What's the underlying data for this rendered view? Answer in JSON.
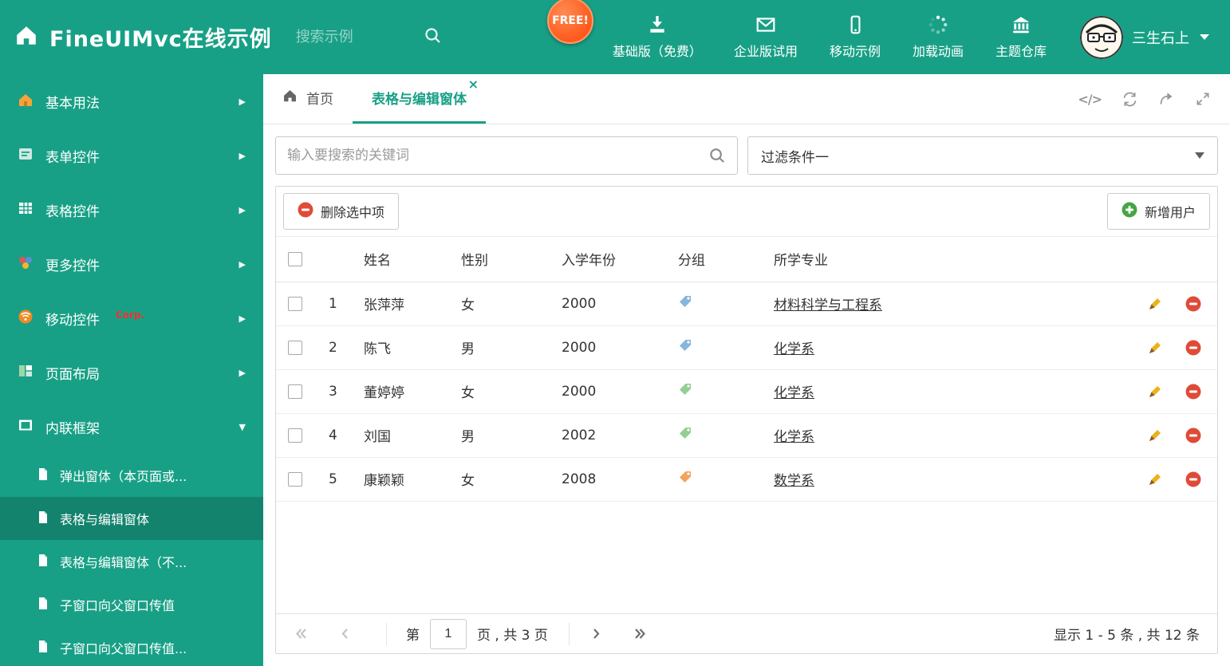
{
  "colors": {
    "accent": "#18a086",
    "free_badge": "#ff5a1e",
    "danger": "#df4b38",
    "success": "#46a546",
    "pencil": "#eab31c",
    "tag_blue": "#85b7dd",
    "tag_green": "#93cf93",
    "tag_orange": "#f2a45f"
  },
  "icons": {
    "close": "×",
    "code": "</>",
    "chevron_right": "▶",
    "chevron_down": "▼"
  },
  "header": {
    "title": "FineUIMvc在线示例",
    "search_placeholder": "搜索示例",
    "free_badge": "FREE!",
    "nav": [
      {
        "label": "基础版（免费）",
        "icon": "download-icon"
      },
      {
        "label": "企业版试用",
        "icon": "envelope-icon"
      },
      {
        "label": "移动示例",
        "icon": "mobile-icon"
      },
      {
        "label": "加载动画",
        "icon": "spinner-icon"
      },
      {
        "label": "主题仓库",
        "icon": "bank-icon"
      }
    ],
    "user_name": "三生石上"
  },
  "sidebar": {
    "items": [
      {
        "label": "基本用法"
      },
      {
        "label": "表单控件"
      },
      {
        "label": "表格控件"
      },
      {
        "label": "更多控件"
      },
      {
        "label": "移动控件",
        "badge": "Corp."
      },
      {
        "label": "页面布局"
      },
      {
        "label": "内联框架"
      }
    ],
    "subitems": [
      {
        "label": "弹出窗体（本页面或..."
      },
      {
        "label": "表格与编辑窗体"
      },
      {
        "label": "表格与编辑窗体（不..."
      },
      {
        "label": "子窗口向父窗口传值"
      },
      {
        "label": "子窗口向父窗口传值..."
      }
    ]
  },
  "tabs": {
    "home": "首页",
    "active": "表格与编辑窗体"
  },
  "filters": {
    "search_placeholder": "输入要搜索的关键词",
    "filter_value": "过滤条件一"
  },
  "toolbar": {
    "delete_label": "删除选中项",
    "add_label": "新增用户"
  },
  "table": {
    "headers": {
      "name": "姓名",
      "gender": "性别",
      "year": "入学年份",
      "group": "分组",
      "major": "所学专业"
    },
    "rows": [
      {
        "index": "1",
        "name": "张萍萍",
        "gender": "女",
        "year": "2000",
        "tag_color": "#85b7dd",
        "major": "材料科学与工程系"
      },
      {
        "index": "2",
        "name": "陈飞",
        "gender": "男",
        "year": "2000",
        "tag_color": "#85b7dd",
        "major": "化学系"
      },
      {
        "index": "3",
        "name": "董婷婷",
        "gender": "女",
        "year": "2000",
        "tag_color": "#93cf93",
        "major": "化学系"
      },
      {
        "index": "4",
        "name": "刘国",
        "gender": "男",
        "year": "2002",
        "tag_color": "#93cf93",
        "major": "化学系"
      },
      {
        "index": "5",
        "name": "康颖颖",
        "gender": "女",
        "year": "2008",
        "tag_color": "#f2a45f",
        "major": "数学系"
      }
    ]
  },
  "pagination": {
    "page_prefix": "第",
    "page": "1",
    "page_suffix": "页 , 共 3 页",
    "summary": "显示 1 - 5 条 , 共 12 条"
  }
}
